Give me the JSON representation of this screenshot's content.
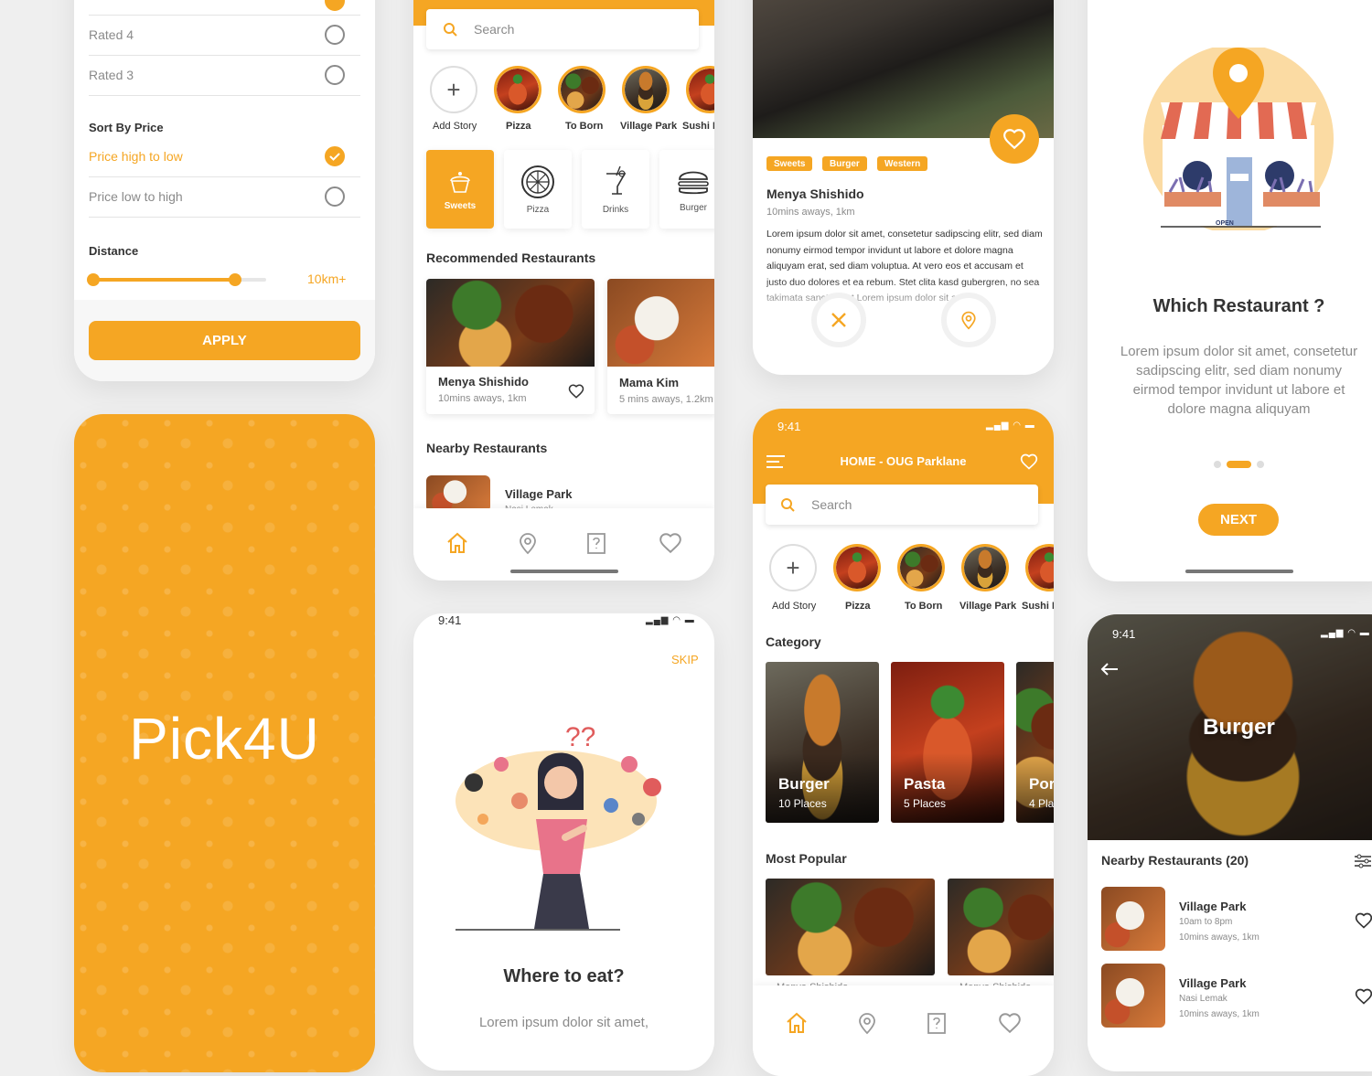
{
  "filter": {
    "rated4": "Rated 4",
    "rated3": "Rated 3",
    "sort_heading": "Sort By Price",
    "price_high": "Price high to low",
    "price_low": "Price low to high",
    "distance_heading": "Distance",
    "distance_value": "10km+",
    "distance_fraction": 0.82,
    "apply": "APPLY"
  },
  "splash": {
    "logo": "Pick4U"
  },
  "home1": {
    "search_placeholder": "Search",
    "stories": [
      "Add Story",
      "Pizza",
      "To Born",
      "Village Park",
      "Sushi M"
    ],
    "categories": [
      "Sweets",
      "Pizza",
      "Drinks",
      "Burger"
    ],
    "recommended_heading": "Recommended Restaurants",
    "recommended": [
      {
        "name": "Menya Shishido",
        "meta": "10mins aways, 1km"
      },
      {
        "name": "Mama Kim",
        "meta": "5 mins aways, 1.2km"
      }
    ],
    "nearby_heading": "Nearby Restaurants",
    "nearby_first": "Village Park",
    "nearby_first_sub": "Nasi Lemak"
  },
  "onboard1": {
    "time": "9:41",
    "skip": "SKIP",
    "title": "Where to eat?",
    "body": "Lorem ipsum dolor sit amet,"
  },
  "detail": {
    "tags": [
      "Sweets",
      "Burger",
      "Western"
    ],
    "name": "Menya Shishido",
    "meta": "10mins aways, 1km",
    "body": "Lorem ipsum dolor sit amet, consetetur sadipscing elitr, sed diam nonumy eirmod tempor invidunt ut labore et dolore magna aliquyam erat, sed diam voluptua. At vero eos et accusam et justo duo dolores et ea rebum. Stet clita kasd gubergren, no sea takimata sanctus est Lorem ipsum dolor sit amet."
  },
  "home2": {
    "time": "9:41",
    "title": "HOME - OUG Parklane",
    "search_placeholder": "Search",
    "stories": [
      "Add Story",
      "Pizza",
      "To Born",
      "Village Park",
      "Sushi M"
    ],
    "category_heading": "Category",
    "categories": [
      {
        "name": "Burger",
        "count": "10 Places"
      },
      {
        "name": "Pasta",
        "count": "5 Places"
      },
      {
        "name": "Por",
        "count": "4 Pla"
      }
    ],
    "popular_heading": "Most Popular",
    "popular": [
      "Menya Shishido",
      "Menya Shishido"
    ]
  },
  "onboard2": {
    "title": "Which Restaurant ?",
    "body": "Lorem ipsum dolor sit amet, consetetur sadipscing elitr, sed diam nonumy eirmod tempor invidunt ut labore et dolore magna aliquyam",
    "next": "NEXT",
    "open_sign": "OPEN"
  },
  "burger": {
    "time": "9:41",
    "hero_title": "Burger",
    "nearby_heading": "Nearby Restaurants (20)",
    "items": [
      {
        "name": "Village Park",
        "sub": "10am to 8pm",
        "meta": "10mins aways, 1km"
      },
      {
        "name": "Village Park",
        "sub": "Nasi Lemak",
        "meta": "10mins aways, 1km"
      }
    ]
  },
  "colors": {
    "accent": "#f5a623",
    "text": "#333333",
    "muted": "#8a8a8a"
  }
}
